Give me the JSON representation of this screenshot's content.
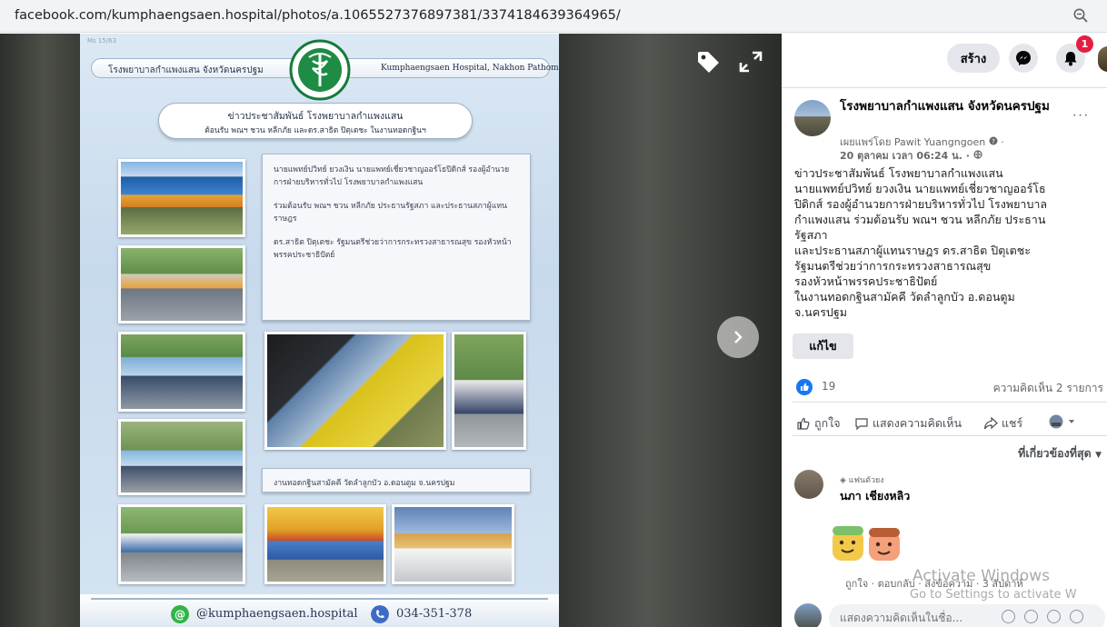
{
  "browser": {
    "url": "facebook.com/kumphaengsaen.hospital/photos/a.1065527376897381/3374184639364965/",
    "zoom_icon": "zoom-icon"
  },
  "poster": {
    "code": "Ms 15/63",
    "header_thai": "โรงพยาบาลกำแพงแสน จังหวัดนครปฐม",
    "header_english": "Kumphaengsaen Hospital, Nakhon Pathom",
    "news_title": "ข่าวประชาสัมพันธ์ โรงพยาบาลกำแพงแสน",
    "news_subtitle": "ต้อนรับ พณฯ ชวน หลีกภัย และดร.สาธิต ปิตุเตชะ ในงานทอดกฐินฯ",
    "info_lines": [
      "นายแพทย์ปวิทย์ ยวงเงิน นายแพทย์เชี่ยวชาญออร์โธปิดิกส์ รองผู้อำนวยการฝ่ายบริหารทั่วไป โรงพยาบาลกำแพงแสน",
      "ร่วมต้อนรับ พณฯ ชวน หลีกภัย ประธานรัฐสภา และประธานสภาผู้แทนราษฎร",
      "ดร.สาธิต ปิตุเตชะ รัฐมนตรีช่วยว่าการกระทรวงสาธารณสุข รองหัวหน้าพรรคประชาธิปัตย์"
    ],
    "event_line": "งานทอดกฐินสามัคคี วัดลำลูกบัว อ.ดอนตูม จ.นครปฐม",
    "line_id": "@kumphaengsaen.hospital",
    "phone": "034-351-378"
  },
  "viewer": {
    "tag_icon": "tag-icon",
    "expand_icon": "expand-icon",
    "next_icon": "chevron-right-icon"
  },
  "topbar": {
    "create_label": "สร้าง",
    "notification_count": "1"
  },
  "post": {
    "page_name": "โรงพยาบาลกำแพงแสน จังหวัดนครปฐม",
    "posted_by": "เผยแพร่โดย Pawit Yuangngoen",
    "time": "20 ตุลาคม เวลา 06:24 น. ·",
    "text_lines": [
      "ข่าวประชาสัมพันธ์ โรงพยาบาลกำแพงแสน",
      "นายแพทย์ปวิทย์ ยวงเงิน นายแพทย์เชี่ยวชาญออร์โธ",
      "ปิดิกส์ รองผู้อำนวยการฝ่ายบริหารทั่วไป โรงพยาบาล",
      "กำแพงแสน ร่วมต้อนรับ พณฯ ชวน หลีกภัย ประธาน",
      "รัฐสภา",
      "และประธานสภาผู้แทนราษฎร ดร.สาธิต ปิตุเตชะ",
      "รัฐมนตรีช่วยว่าการกระทรวงสาธารณสุข",
      "รองหัวหน้าพรรคประชาธิปัตย์",
      "ในงานทอดกฐินสามัคคี วัดลำลูกบัว อ.ดอนตูม",
      "จ.นครปฐม"
    ],
    "edit_label": "แก้ไข",
    "like_count": "19",
    "comment_count": "ความคิดเห็น 2 รายการ",
    "like_label": "ถูกใจ",
    "comment_label": "แสดงความคิดเห็น",
    "share_label": "แชร์",
    "sort_label": "ที่เกี่ยวข้องที่สุด"
  },
  "comment": {
    "badge": "แฟนตัวยง",
    "author": "นภา เชียงหลิว",
    "actions": "ถูกใจ · ตอบกลับ · ส่งข้อความ · 3 สัปดาห์"
  },
  "comment_input": {
    "placeholder": "แสดงความคิดเห็นในชื่อ..."
  },
  "watermark": {
    "line1": "Activate Windows",
    "line2": "Go to Settings to activate W"
  },
  "colors": {
    "facebook_blue": "#1877f2",
    "notification_red": "#e41e3f",
    "line_green": "#2fb546",
    "phone_blue": "#3d6cc5"
  }
}
